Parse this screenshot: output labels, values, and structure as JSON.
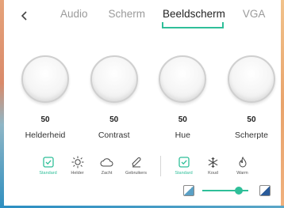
{
  "header": {
    "back_icon": "chevron-left-icon",
    "tabs": [
      {
        "label": "Audio",
        "active": false
      },
      {
        "label": "Scherm",
        "active": false
      },
      {
        "label": "Beeldscherm",
        "active": true
      },
      {
        "label": "VGA",
        "active": false
      }
    ]
  },
  "knobs": [
    {
      "value": "50",
      "label": "Helderheid"
    },
    {
      "value": "50",
      "label": "Contrast"
    },
    {
      "value": "50",
      "label": "Hue"
    },
    {
      "value": "50",
      "label": "Scherpte"
    }
  ],
  "presets_left": [
    {
      "label": "Standard",
      "icon": "check-square-icon",
      "active": true
    },
    {
      "label": "Helder",
      "icon": "sun-icon",
      "active": false
    },
    {
      "label": "Zacht",
      "icon": "cloud-icon",
      "active": false
    },
    {
      "label": "Gebruikers",
      "icon": "pen-icon",
      "active": false
    }
  ],
  "presets_right": [
    {
      "label": "Standard",
      "icon": "check-square-icon",
      "active": true
    },
    {
      "label": "Koud",
      "icon": "snowflake-icon",
      "active": false
    },
    {
      "label": "Warm",
      "icon": "flame-icon",
      "active": false
    }
  ],
  "backlight_slider": {
    "level": 0.8,
    "decrease_icon": "brightness-down-icon",
    "increase_icon": "brightness-up-icon"
  },
  "colors": {
    "accent": "#2fbf99",
    "text": "#222222",
    "muted": "#9a9a9a"
  }
}
